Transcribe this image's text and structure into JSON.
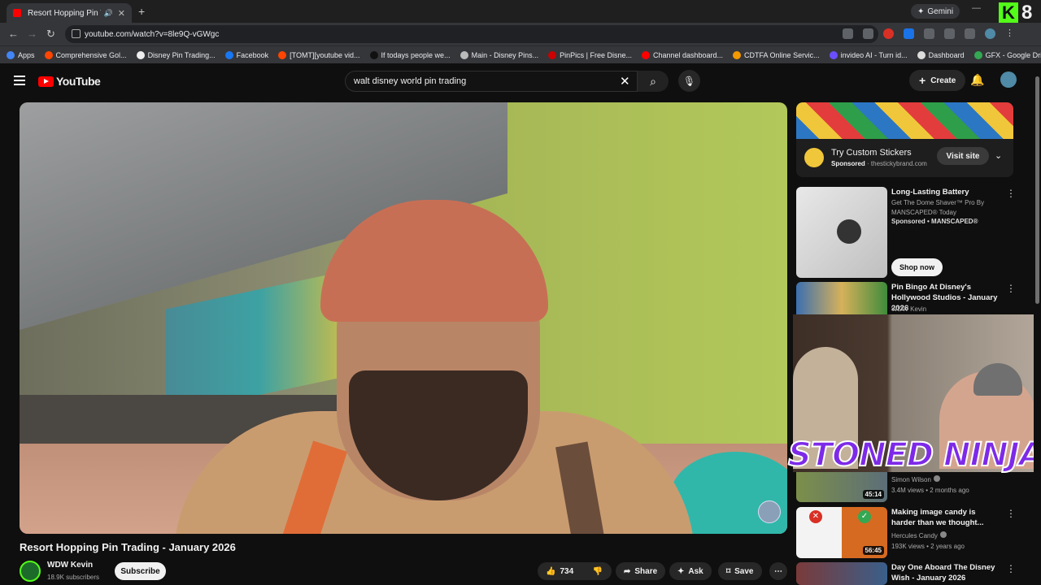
{
  "browser": {
    "tab_title": "Resort Hopping Pin Trading",
    "new_tab": "+",
    "gemini_label": "Gemini",
    "k8_label": "8",
    "url": "youtube.com/watch?v=8le9Q-vGWgc"
  },
  "bookmarks": [
    {
      "label": "Apps",
      "color": "#4285f4"
    },
    {
      "label": "Comprehensive Gol...",
      "color": "#ff4500"
    },
    {
      "label": "Disney Pin Trading...",
      "color": "#eeeeee"
    },
    {
      "label": "Facebook",
      "color": "#1877f2"
    },
    {
      "label": "[TOMT][youtube vid...",
      "color": "#ff4500"
    },
    {
      "label": "If todays people we...",
      "color": "#111111"
    },
    {
      "label": "Main - Disney Pins...",
      "color": "#bbbbbb"
    },
    {
      "label": "PinPics | Free Disne...",
      "color": "#cc0000"
    },
    {
      "label": "Channel dashboard...",
      "color": "#ff0000"
    },
    {
      "label": "CDTFA Online Servic...",
      "color": "#f29900"
    },
    {
      "label": "invideo AI - Turn id...",
      "color": "#6b4eff"
    },
    {
      "label": "Dashboard",
      "color": "#dddddd"
    },
    {
      "label": "GFX - Google Drive",
      "color": "#34a853"
    }
  ],
  "youtube": {
    "logo_text": "YouTube",
    "search_value": "walt disney world pin trading",
    "create_label": "Create"
  },
  "video": {
    "title": "Resort Hopping Pin Trading - January 2026",
    "channel": "WDW Kevin",
    "subscribers": "18.9K subscribers",
    "subscribe_label": "Subscribe",
    "likes": "734",
    "share_label": "Share",
    "ask_label": "Ask",
    "save_label": "Save"
  },
  "ad": {
    "title": "Try Custom Stickers",
    "sponsored": "Sponsored",
    "domain": "thestickybrand.com",
    "visit_label": "Visit site"
  },
  "recommendations": [
    {
      "title": "Long-Lasting Battery",
      "desc": "Get The Dome Shaver™ Pro By MANSCAPED® Today",
      "channel": "Sponsored • MANSCAPED®",
      "cta": "Shop now"
    },
    {
      "title": "Pin Bingo At Disney's Hollywood Studios - January 2026",
      "channel": "WDW Kevin"
    },
    {
      "title": "",
      "channel": "Simon Wilson",
      "meta": "3.4M views • 2 months ago",
      "duration": "45:14"
    },
    {
      "title": "Making image candy is harder than we thought...",
      "channel": "Hercules Candy",
      "meta": "193K views • 2 years ago",
      "duration": "56:45"
    },
    {
      "title": "Day One Aboard The Disney Wish - January 2026"
    }
  ],
  "overlay": {
    "text": "STONED NINJA"
  }
}
